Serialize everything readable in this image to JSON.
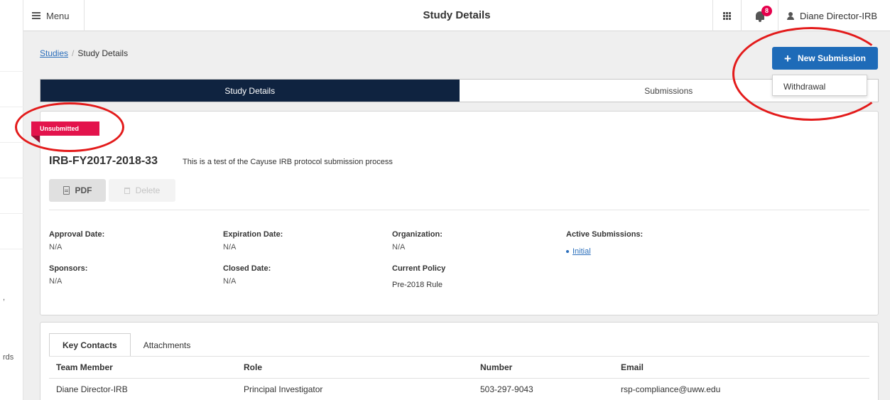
{
  "gutter": {
    "texts": [
      ",",
      "rds"
    ]
  },
  "header": {
    "menu_label": "Menu",
    "title": "Study Details",
    "notification_count": "8",
    "user_name": "Diane Director-IRB"
  },
  "breadcrumb": {
    "link": "Studies",
    "separator": "/",
    "current": "Study Details"
  },
  "actions": {
    "new_submission_icon": "+",
    "new_submission_label": "New Submission",
    "dropdown_items": [
      "Withdrawal"
    ]
  },
  "tabs": [
    {
      "label": "Study Details",
      "active": true
    },
    {
      "label": "Submissions",
      "active": false
    }
  ],
  "study": {
    "status": "Unsubmitted",
    "id": "IRB-FY2017-2018-33",
    "description": "This is a test of the Cayuse IRB protocol submission process",
    "pdf_label": "PDF",
    "delete_label": "Delete"
  },
  "fields": {
    "approval_date_label": "Approval Date:",
    "approval_date": "N/A",
    "expiration_date_label": "Expiration Date:",
    "expiration_date": "N/A",
    "organization_label": "Organization:",
    "organization": "N/A",
    "active_submissions_label": "Active Submissions:",
    "active_submission_item": "Initial",
    "sponsors_label": "Sponsors:",
    "sponsors": "N/A",
    "closed_date_label": "Closed Date:",
    "closed_date": "N/A",
    "current_policy_label": "Current Policy",
    "current_policy": "Pre-2018 Rule"
  },
  "contacts": {
    "tabs": [
      "Key Contacts",
      "Attachments"
    ],
    "columns": [
      "Team Member",
      "Role",
      "Number",
      "Email"
    ],
    "rows": [
      [
        "Diane Director-IRB",
        "Principal Investigator",
        "503-297-9043",
        "rsp-compliance@uww.edu"
      ]
    ]
  },
  "colors": {
    "accent_blue": "#1e6bb8",
    "nav_dark": "#0f2340",
    "status_red": "#e3134c",
    "annotation_red": "#e31b1b"
  },
  "icons": [
    "hamburger-icon",
    "apps-grid-icon",
    "bell-icon",
    "user-icon",
    "plus-icon",
    "pdf-file-icon",
    "trash-icon"
  ]
}
